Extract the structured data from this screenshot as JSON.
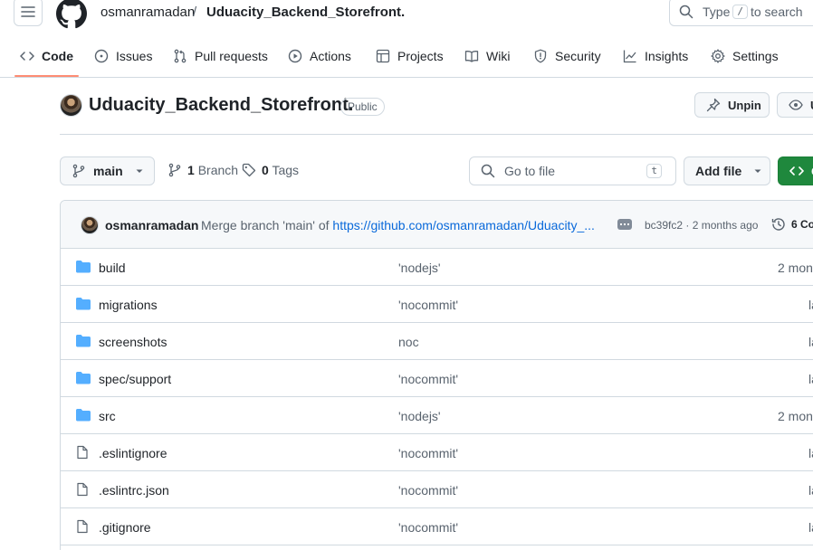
{
  "header": {
    "owner": "osmanramadan",
    "separator": "/",
    "repo": "Uduacity_Backend_Storefront.",
    "search_prefix": "Type",
    "search_key": "/",
    "search_suffix": "to search"
  },
  "nav": {
    "tabs": [
      {
        "label": "Code",
        "icon": "code-icon",
        "selected": true
      },
      {
        "label": "Issues",
        "icon": "issue-icon"
      },
      {
        "label": "Pull requests",
        "icon": "pull-request-icon"
      },
      {
        "label": "Actions",
        "icon": "play-icon"
      },
      {
        "label": "Projects",
        "icon": "table-icon"
      },
      {
        "label": "Wiki",
        "icon": "book-icon"
      },
      {
        "label": "Security",
        "icon": "shield-icon"
      },
      {
        "label": "Insights",
        "icon": "graph-icon"
      },
      {
        "label": "Settings",
        "icon": "gear-icon"
      }
    ]
  },
  "repo_header": {
    "title": "Uduacity_Backend_Storefront.",
    "visibility": "Public",
    "unpin_label": "Unpin",
    "watch_label": "U"
  },
  "toolbar": {
    "branch": "main",
    "branch_count": "1",
    "branch_label": "Branch",
    "tag_count": "0",
    "tag_label": "Tags",
    "goto_placeholder": "Go to file",
    "goto_key": "t",
    "add_file": "Add file",
    "code_label": "C"
  },
  "commit": {
    "author": "osmanramadan",
    "message": "Merge branch 'main' of",
    "link": "https://github.com/osmanramadan/Uduacity_...",
    "hash": "bc39fc2",
    "separator": "·",
    "time": "2 months ago",
    "history": "6 Co"
  },
  "files": [
    {
      "name": "build",
      "type": "folder",
      "message": "'nodejs'",
      "date": "2 mon"
    },
    {
      "name": "migrations",
      "type": "folder",
      "message": "'nocommit'",
      "date": "la"
    },
    {
      "name": "screenshots",
      "type": "folder",
      "message": "noc",
      "date": "la"
    },
    {
      "name": "spec/support",
      "type": "folder",
      "message": "'nocommit'",
      "date": "la"
    },
    {
      "name": "src",
      "type": "folder",
      "message": "'nodejs'",
      "date": "2 mon"
    },
    {
      "name": ".eslintignore",
      "type": "file",
      "message": "'nocommit'",
      "date": "la"
    },
    {
      "name": ".eslintrc.json",
      "type": "file",
      "message": "'nocommit'",
      "date": "la"
    },
    {
      "name": ".gitignore",
      "type": "file",
      "message": "'nocommit'",
      "date": "la"
    }
  ],
  "colors": {
    "accent_underline": "#fd8c73",
    "folder": "#54aeff",
    "link": "#0969da",
    "code_button": "#1f883d"
  }
}
